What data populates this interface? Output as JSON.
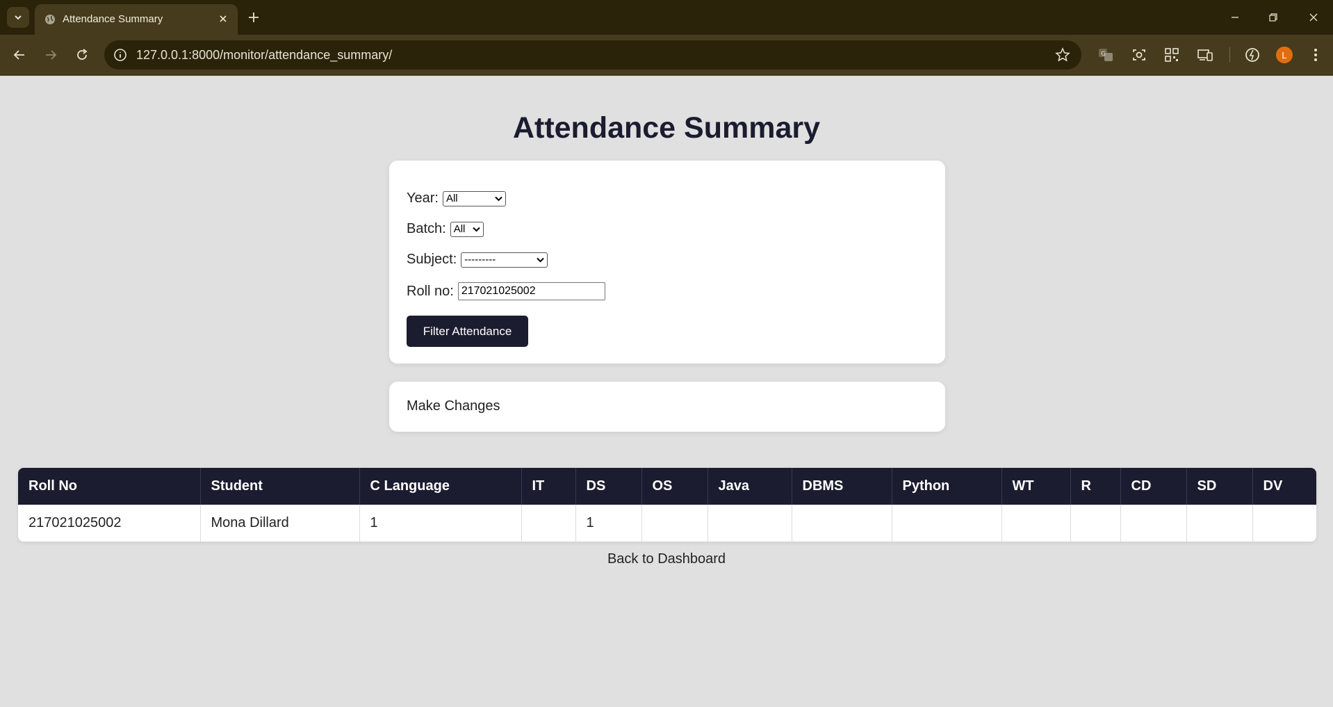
{
  "browser": {
    "tab_title": "Attendance Summary",
    "url": "127.0.0.1:8000/monitor/attendance_summary/",
    "profile_initial": "L"
  },
  "page": {
    "title": "Attendance Summary",
    "filters": {
      "year_label": "Year:",
      "year_value": "All",
      "batch_label": "Batch:",
      "batch_value": "All",
      "subject_label": "Subject:",
      "subject_value": "---------",
      "rollno_label": "Roll no:",
      "rollno_value": "217021025002",
      "submit_label": "Filter Attendance"
    },
    "make_changes_label": "Make Changes",
    "table": {
      "columns": [
        "Roll No",
        "Student",
        "C Language",
        "IT",
        "DS",
        "OS",
        "Java",
        "DBMS",
        "Python",
        "WT",
        "R",
        "CD",
        "SD",
        "DV"
      ],
      "rows": [
        [
          "217021025002",
          "Mona Dillard",
          "1",
          "",
          "1",
          "",
          "",
          "",
          "",
          "",
          "",
          "",
          "",
          ""
        ]
      ]
    },
    "back_link": "Back to Dashboard"
  },
  "colors": {
    "header_bg": "#1c1c30",
    "page_bg": "#e0e0e0",
    "chrome_dark": "#2b2309",
    "chrome_light": "#463b1c",
    "avatar": "#e26d0e"
  }
}
